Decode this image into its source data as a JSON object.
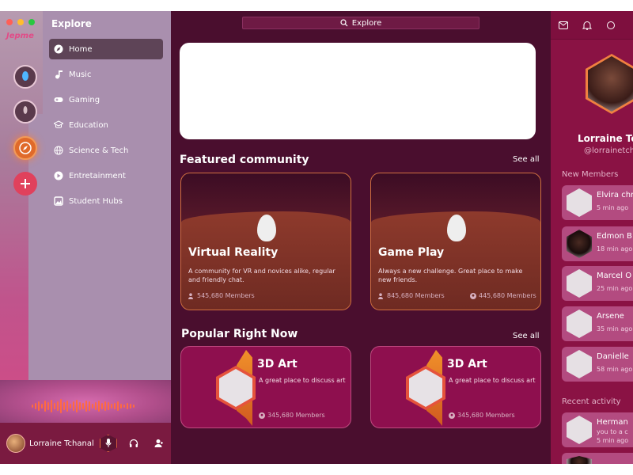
{
  "window": {
    "traffic_colors": [
      "#ff5f57",
      "#ffbd2e",
      "#28c840"
    ]
  },
  "app": {
    "logo_text": "Jepme"
  },
  "sidebar": {
    "title": "Explore",
    "items": [
      {
        "label": "Home",
        "icon": "compass-icon",
        "active": true
      },
      {
        "label": "Music",
        "icon": "music-note-icon"
      },
      {
        "label": "Gaming",
        "icon": "gamepad-icon"
      },
      {
        "label": "Education",
        "icon": "graduation-cap-icon"
      },
      {
        "label": "Science & Tech",
        "icon": "globe-icon"
      },
      {
        "label": "Entretainment",
        "icon": "play-circle-icon"
      },
      {
        "label": "Student Hubs",
        "icon": "image-icon"
      }
    ]
  },
  "userbar": {
    "name": "Lorraine Tchanal"
  },
  "search": {
    "placeholder": "Explore"
  },
  "featured": {
    "title": "Featured community",
    "see_all": "See all",
    "cards": [
      {
        "title": "Virtual Reality",
        "desc": "A community for VR and novices alike, regular and friendly chat.",
        "members": "545,680 Members",
        "online": ""
      },
      {
        "title": "Game Play",
        "desc": "Always a new challenge. Great place to make new friends.",
        "members": "845,680 Members",
        "online": "445,680 Members"
      }
    ]
  },
  "popular": {
    "title": "Popular Right Now",
    "see_all": "See all",
    "cards": [
      {
        "title": "3D Art",
        "desc": "A great place to discuss art",
        "members": "345,680 Members"
      },
      {
        "title": "3D Art",
        "desc": "A great place to discuss art",
        "members": "345,680 Members"
      }
    ]
  },
  "profile": {
    "name": "Lorraine Tch",
    "handle": "@lorrainetcha"
  },
  "new_members": {
    "title": "New Members",
    "items": [
      {
        "name": "Elvira chr",
        "time": "5 min ago"
      },
      {
        "name": "Edmon B",
        "time": "18 min ago"
      },
      {
        "name": "Marcel O",
        "time": "25 min ago"
      },
      {
        "name": "Arsene",
        "time": "35 min ago"
      },
      {
        "name": "Danielle",
        "time": "58 min ago"
      }
    ]
  },
  "recent_activity": {
    "title": "Recent activity",
    "items": [
      {
        "name": "Herman",
        "text": "you to a c",
        "time": "5 min ago"
      }
    ]
  }
}
